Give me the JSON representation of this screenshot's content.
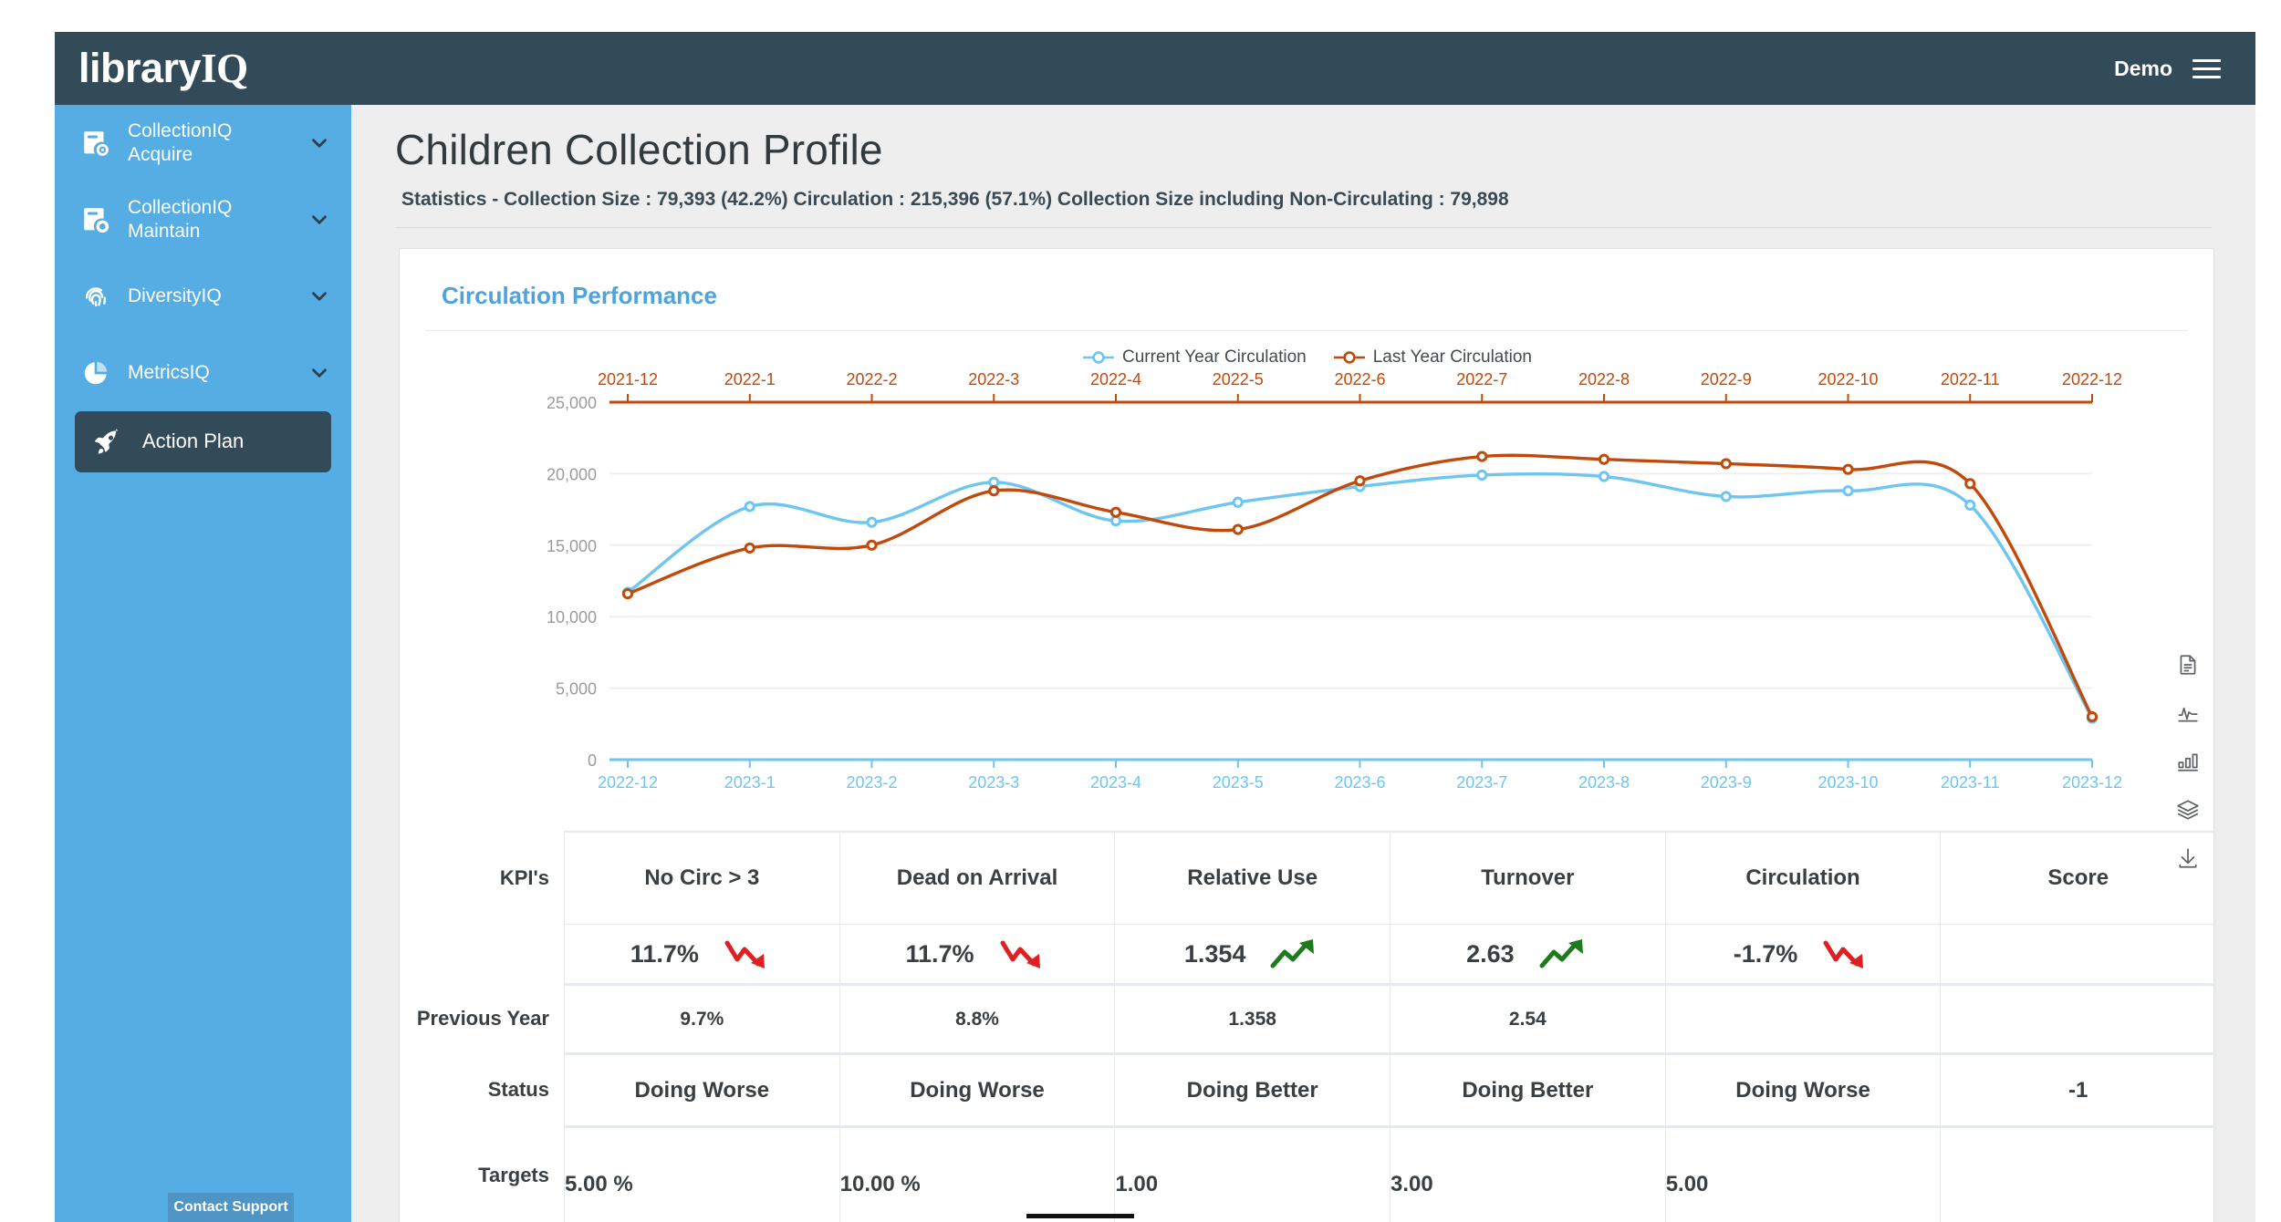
{
  "header": {
    "brand_part1": "library",
    "brand_part2": "IQ",
    "user_label": "Demo",
    "menu_icon": "hamburger-icon"
  },
  "sidebar": {
    "items": [
      {
        "label_line1": "CollectionIQ",
        "label_line2": "Acquire",
        "icon": "collection-acquire-icon",
        "expandable": true,
        "active": false
      },
      {
        "label_line1": "CollectionIQ",
        "label_line2": "Maintain",
        "icon": "collection-maintain-icon",
        "expandable": true,
        "active": false
      },
      {
        "label_line1": "DiversityIQ",
        "label_line2": "",
        "icon": "fingerprint-icon",
        "expandable": true,
        "active": false
      },
      {
        "label_line1": "MetricsIQ",
        "label_line2": "",
        "icon": "pie-chart-icon",
        "expandable": true,
        "active": false
      },
      {
        "label_line1": "Action Plan",
        "label_line2": "",
        "icon": "rocket-icon",
        "expandable": false,
        "active": true
      }
    ],
    "contact_support": "Contact Support"
  },
  "main": {
    "page_title": "Children Collection Profile",
    "stats_line": "Statistics - Collection Size : 79,393 (42.2%) Circulation : 215,396 (57.1%)  Collection Size including Non-Circulating : 79,898"
  },
  "card": {
    "title": "Circulation Performance"
  },
  "tools": [
    {
      "name": "document-icon"
    },
    {
      "name": "line-chart-icon"
    },
    {
      "name": "bar-chart-icon"
    },
    {
      "name": "layers-icon"
    },
    {
      "name": "download-icon"
    }
  ],
  "colors": {
    "current_year": "#6ec6f0",
    "last_year": "#c1490b",
    "accent_blue": "#4fa3dd",
    "sidebar_blue": "#55ade4",
    "dark_navy": "#334a59",
    "up_green": "#1d7a1d",
    "down_red": "#e02020"
  },
  "chart_data": {
    "type": "line",
    "title": "Circulation Performance",
    "xlabel": "",
    "ylabel": "",
    "ylim": [
      0,
      25000
    ],
    "yticks": [
      0,
      5000,
      10000,
      15000,
      20000,
      25000
    ],
    "ytick_labels": [
      "0",
      "5,000",
      "10,000",
      "15,000",
      "20,000",
      "25,000"
    ],
    "grid": true,
    "legend_position": "top-center",
    "x_top_axis_label": "Last Year Circulation",
    "x_bottom_axis_label": "Current Year Circulation",
    "x_top": [
      "2021-12",
      "2022-1",
      "2022-2",
      "2022-3",
      "2022-4",
      "2022-5",
      "2022-6",
      "2022-7",
      "2022-8",
      "2022-9",
      "2022-10",
      "2022-11",
      "2022-12"
    ],
    "x_bottom": [
      "2022-12",
      "2023-1",
      "2023-2",
      "2023-3",
      "2023-4",
      "2023-5",
      "2023-6",
      "2023-7",
      "2023-8",
      "2023-9",
      "2023-10",
      "2023-11",
      "2023-12"
    ],
    "series": [
      {
        "name": "Current Year Circulation",
        "color": "#6ec6f0",
        "axis": "bottom",
        "values": [
          11700,
          17700,
          16600,
          19400,
          16700,
          18000,
          19100,
          19900,
          19800,
          18400,
          18800,
          17800,
          2900
        ]
      },
      {
        "name": "Last Year Circulation",
        "color": "#c1490b",
        "axis": "top",
        "values": [
          11600,
          14800,
          15000,
          18800,
          17300,
          16100,
          19500,
          21200,
          21000,
          20700,
          20300,
          19300,
          3000
        ]
      }
    ]
  },
  "kpi_table": {
    "row_labels": {
      "kpis": "KPI's",
      "previous_year": "Previous Year",
      "status": "Status",
      "targets": "Targets"
    },
    "columns": [
      "No Circ > 3",
      "Dead on Arrival",
      "Relative Use",
      "Turnover",
      "Circulation",
      "Score"
    ],
    "values": [
      "11.7%",
      "11.7%",
      "1.354",
      "2.63",
      "-1.7%",
      ""
    ],
    "trends": [
      "down",
      "down",
      "up",
      "up",
      "down",
      ""
    ],
    "previous_year": [
      "9.7%",
      "8.8%",
      "1.358",
      "2.54",
      "",
      ""
    ],
    "status": [
      "Doing Worse",
      "Doing Worse",
      "Doing Better",
      "Doing Better",
      "Doing Worse",
      "-1"
    ],
    "targets": [
      "5.00 %",
      "10.00 %",
      "1.00",
      "3.00",
      "5.00",
      ""
    ]
  }
}
